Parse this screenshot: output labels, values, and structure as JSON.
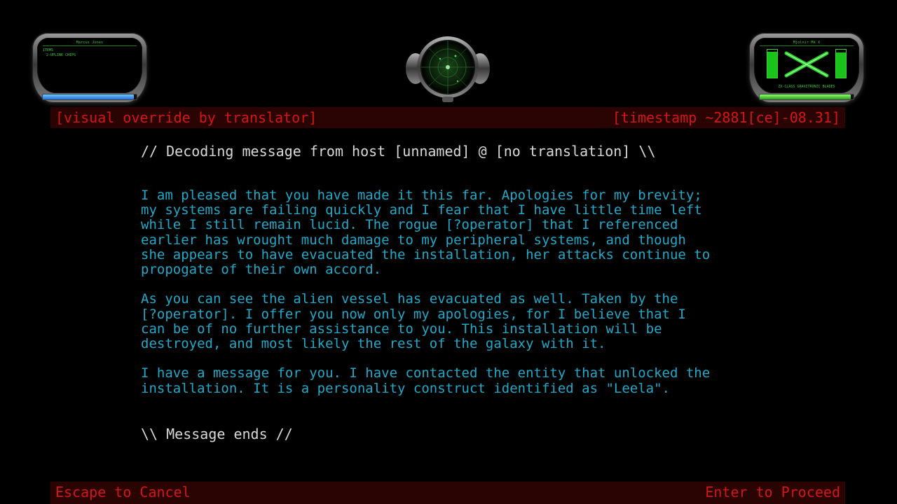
{
  "hud_left": {
    "player_name": "Marcus Jones",
    "items_label": "ITEMS",
    "items": [
      "2-UPLINK CHIPS"
    ],
    "health_fraction": 0.97
  },
  "hud_right": {
    "weapon_name": "Mjolnir Mk X",
    "weapon_type": "ZX-CLASS GRAVITRONIC BLADES",
    "left_gauge_fraction": 0.92,
    "right_gauge_fraction": 0.9,
    "energy_fraction": 0.97
  },
  "header": {
    "left": "[visual override by translator]",
    "right": "[timestamp ~2881[ce]-08.31]"
  },
  "message": {
    "header": "// Decoding message from host [unnamed] @ [no translation] \\\\",
    "paragraphs": [
      "I am pleased that you have made it this far. Apologies for my brevity;\nmy systems are failing quickly and I fear that I have little time left\nwhile I still remain lucid. The rogue [?operator] that I referenced\nearlier has wrought much damage to my peripheral systems, and though\nshe appears to have evacuated the installation, her attacks continue to\npropogate of their own accord.",
      "As you can see the alien vessel has evacuated as well. Taken by the\n[?operator]. I offer you now only my apologies, for I believe that I\ncan be of no further assistance to you. This installation will be\ndestroyed, and most likely the rest of the galaxy with it.",
      "I have a message for you. I have contacted the entity that unlocked the\ninstallation. It is a personality construct identified as \"Leela\"."
    ],
    "footer": "\\\\ Message ends //"
  },
  "footer": {
    "cancel": "Escape to Cancel",
    "proceed": "Enter to Proceed"
  },
  "colors": {
    "message_text": "#22a9c9",
    "header_text": "#d21717",
    "header_bg": "#2a0303",
    "hud_green": "#3fce3f",
    "health_bar": "#2474d6"
  }
}
